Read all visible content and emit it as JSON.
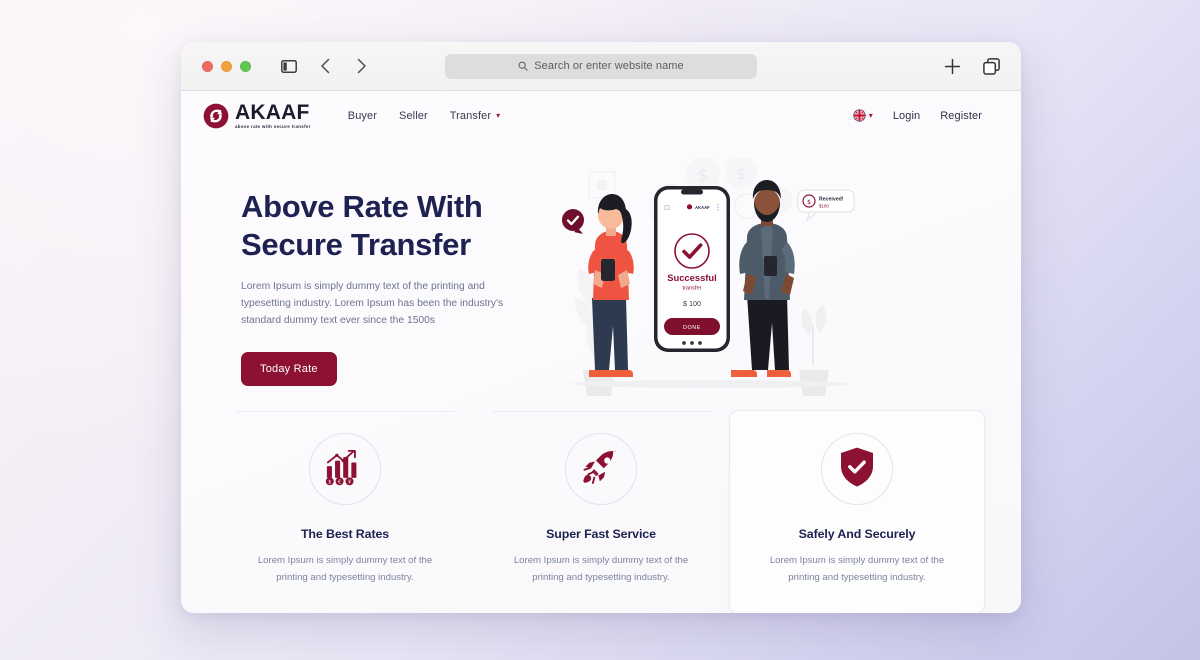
{
  "browser": {
    "traffic_lights": [
      "close",
      "minimize",
      "maximize"
    ],
    "sidebar_icon": "sidebar-toggle-icon",
    "back_icon": "chevron-left-icon",
    "forward_icon": "chevron-right-icon",
    "address_placeholder": "Search or enter website name",
    "search_icon": "magnifier-icon",
    "new_tab_icon": "plus-icon",
    "tab_overview_icon": "tab-stack-icon"
  },
  "site": {
    "brand": {
      "name": "AKAAF",
      "tagline": "above rate with secure transfer",
      "logo_icon": "akaaf-swirl-logo"
    },
    "nav_links": [
      {
        "label": "Buyer",
        "has_caret": false
      },
      {
        "label": "Seller",
        "has_caret": false
      },
      {
        "label": "Transfer",
        "has_caret": true
      }
    ],
    "caret_glyph": "▾",
    "language": {
      "icon": "uk-flag-icon",
      "caret": "▾"
    },
    "login_label": "Login",
    "register_label": "Register"
  },
  "hero": {
    "title_line1": "Above Rate With",
    "title_line2": "Secure Transfer",
    "subtitle": "Lorem Ipsum is simply dummy text of the printing and typesetting industry. Lorem Ipsum has been the industry's standard dummy text ever since the 1500s",
    "cta_label": "Today Rate"
  },
  "illustration": {
    "phone": {
      "app_logo": "AKAAF",
      "status_icon": "check-circle-icon",
      "title": "Successful",
      "subtitle": "transfer",
      "amount": "$ 100",
      "button_label": "DONE",
      "home_icon": "home-icon",
      "menu_icon": "more-vertical-icon",
      "page_dots": "• • •"
    },
    "left_person": {
      "name": "woman-with-phone",
      "badge_icon": "check-bubble-icon"
    },
    "right_person": {
      "name": "man-with-phone",
      "bubble_title": "Received!",
      "bubble_amount": "$100",
      "bubble_icon": "money-circle-icon"
    },
    "coins": [
      "$",
      "$",
      "$",
      "$",
      "$"
    ]
  },
  "features": [
    {
      "icon": "bar-chart-currency-icon",
      "title": "The Best Rates",
      "desc": "Lorem Ipsum is simply dummy text of the printing and typesetting industry.",
      "highlight": false
    },
    {
      "icon": "rocket-icon",
      "title": "Super Fast Service",
      "desc": "Lorem Ipsum is simply dummy text of the printing and typesetting industry.",
      "highlight": false
    },
    {
      "icon": "shield-check-icon",
      "title": "Safely And Securely",
      "desc": "Lorem Ipsum is simply dummy text of the printing and typesetting industry.",
      "highlight": true
    }
  ],
  "colors": {
    "brand_maroon": "#8c1133",
    "deep_maroon": "#6f0f2b",
    "navy_text": "#1e2252",
    "muted_text": "#6c7490",
    "coral": "#ef5f3c",
    "slate_blue": "#4d5a68",
    "page_bg_start": "#f8f2f7",
    "page_bg_end": "#c3c3e8"
  }
}
